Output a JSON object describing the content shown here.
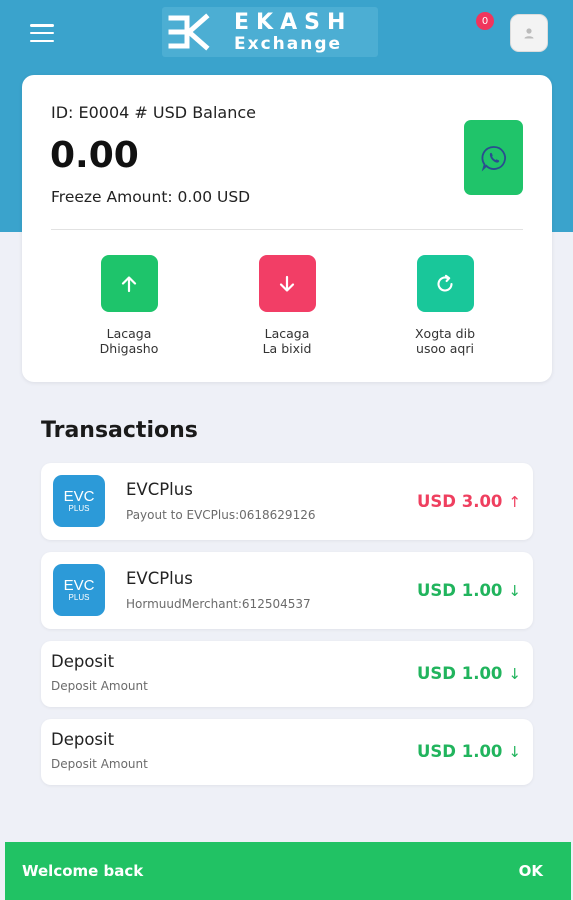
{
  "header": {
    "menu_icon": "hamburger-icon",
    "logo": {
      "line1": "EKASH",
      "line2": "Exchange",
      "mark": "EK"
    },
    "notification_count": "0",
    "avatar_icon": "user-avatar"
  },
  "account": {
    "id_label": "ID: E0004 # USD Balance",
    "balance": "0.00",
    "freeze": "Freeze Amount: 0.00 USD",
    "whatsapp_icon": "whatsapp-icon"
  },
  "actions": [
    {
      "label_line1": "Lacaga",
      "label_line2": "Dhigasho",
      "icon": "arrow-up-icon",
      "color": "#1ec46b"
    },
    {
      "label_line1": "Lacaga",
      "label_line2": "La bixid",
      "icon": "arrow-down-icon",
      "color": "#f23e66"
    },
    {
      "label_line1": "Xogta dib",
      "label_line2": "usoo aqri",
      "icon": "refresh-icon",
      "color": "#19c79a"
    }
  ],
  "transactions": {
    "title": "Transactions",
    "items": [
      {
        "title": "EVCPlus",
        "subtitle": "Payout to EVCPlus:0618629126",
        "amount": "USD 3.00",
        "direction": "↑",
        "logo": "EVC PLUS"
      },
      {
        "title": "EVCPlus",
        "subtitle": "HormuudMerchant:612504537",
        "amount": "USD 1.00",
        "direction": "↓",
        "logo": "EVC PLUS"
      },
      {
        "title": "Deposit",
        "subtitle": "Deposit Amount",
        "amount": "USD 1.00",
        "direction": "↓"
      },
      {
        "title": "Deposit",
        "subtitle": "Deposit Amount",
        "amount": "USD 1.00",
        "direction": "↓"
      }
    ]
  },
  "toast": {
    "message": "Welcome back",
    "ok_label": "OK"
  },
  "colors": {
    "header": "#3aa3cc",
    "background": "#eef0f7",
    "outgoing": "#ef3f5f",
    "incoming": "#21b45d",
    "toast": "#21c264"
  }
}
